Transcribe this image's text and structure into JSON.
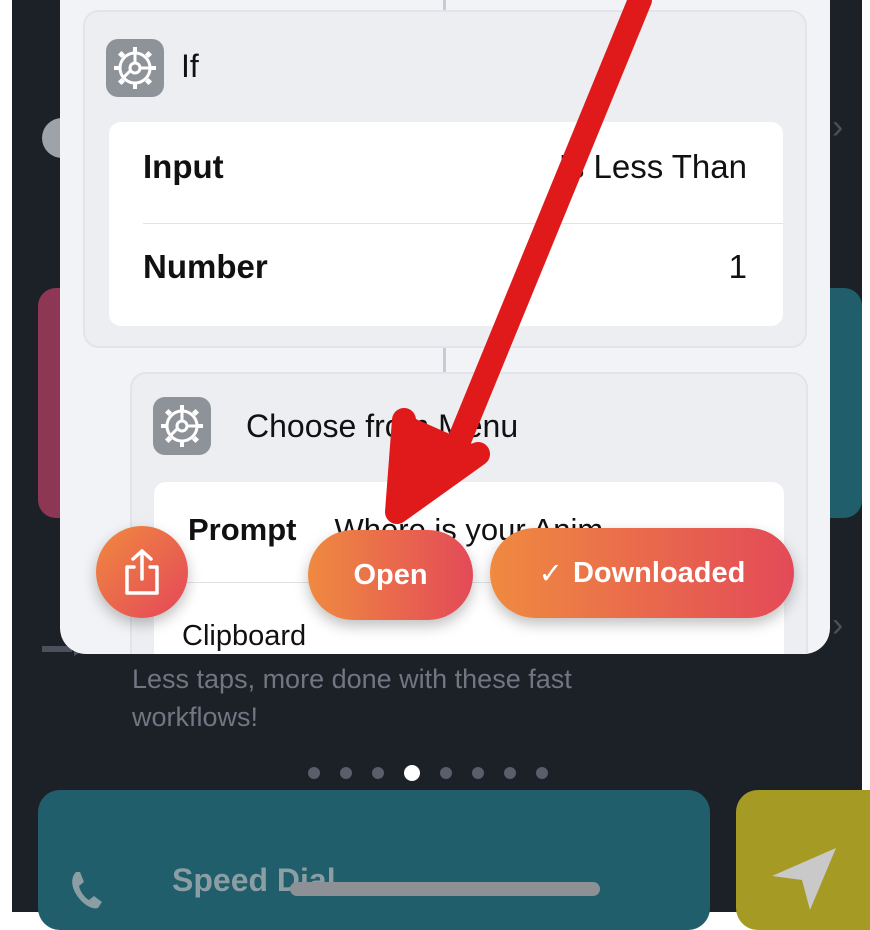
{
  "if_action": {
    "title": "If",
    "rows": [
      {
        "label": "Input",
        "value": "Is Less Than"
      },
      {
        "label": "Number",
        "value": "1"
      }
    ]
  },
  "menu_action": {
    "title": "Choose from Menu",
    "prompt_label": "Prompt",
    "prompt_value": "Where is your Anim",
    "first_item": "Clipboard"
  },
  "buttons": {
    "open": "Open",
    "downloaded": "Downloaded",
    "downloaded_check": "✓"
  },
  "gallery": {
    "subtitle": "Less taps, more done with these fast workflows!",
    "page_dots": 8,
    "active_dot": 4,
    "next_card_title": "Speed Dial"
  },
  "icons": [
    "gear-icon",
    "share-icon",
    "checkmark-icon",
    "phone-icon",
    "location-arrow-icon",
    "chevron-right-icon"
  ],
  "colors": {
    "accent_start": "#ef8a40",
    "accent_end": "#e34a58",
    "annotation_arrow": "#e01a1a",
    "background_dark": "#1c2027"
  }
}
